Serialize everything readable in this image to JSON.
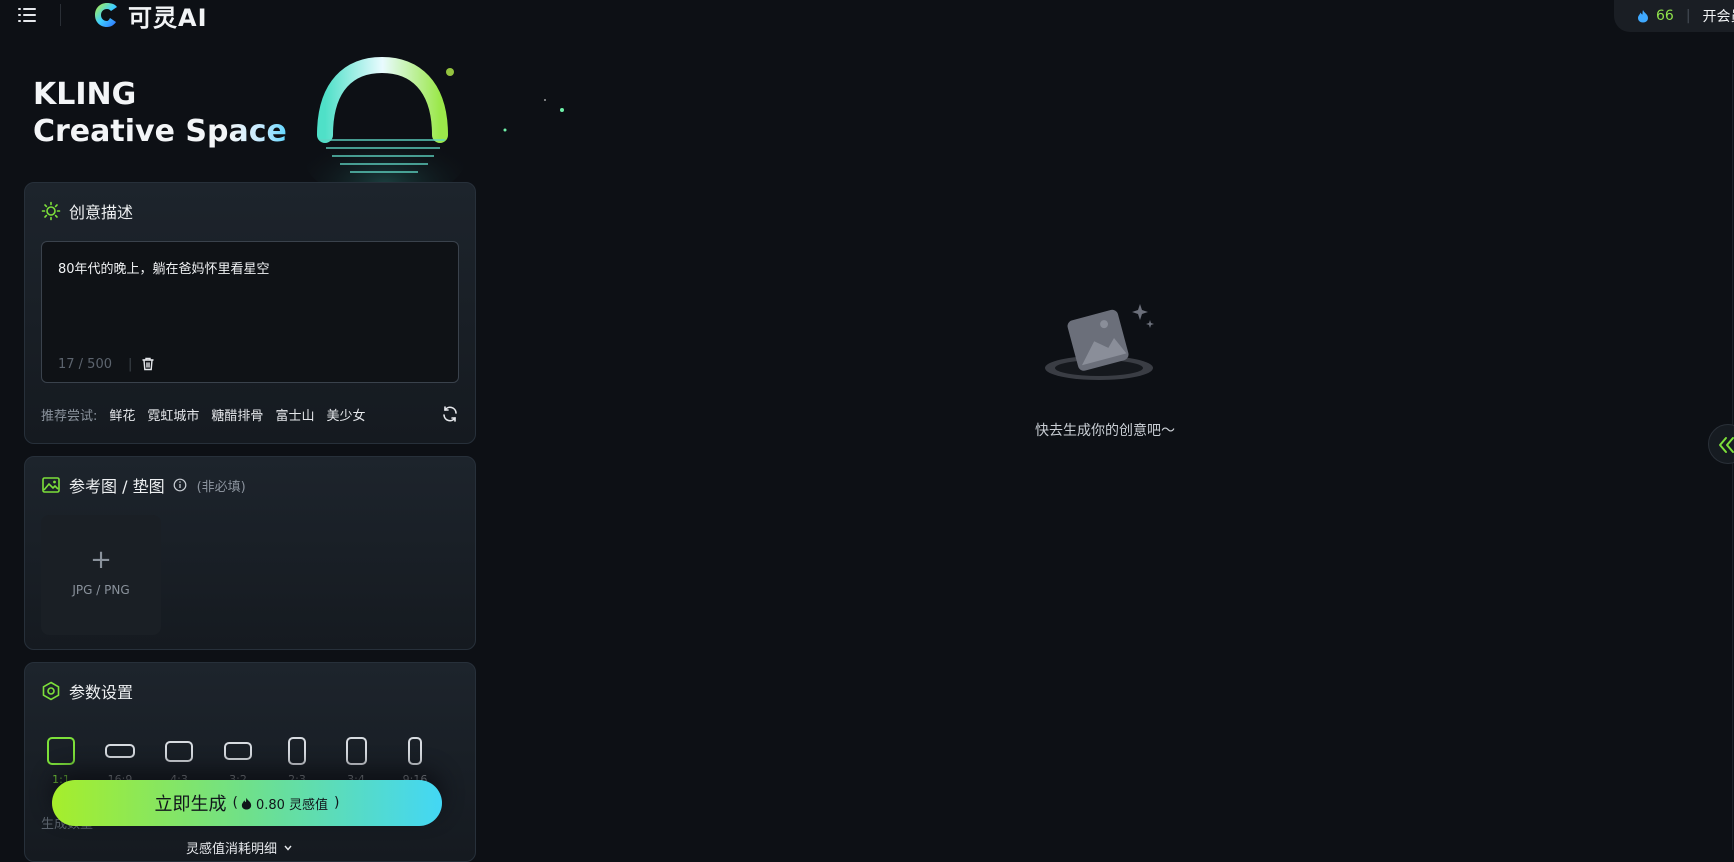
{
  "header": {
    "menu_icon": "menu-icon",
    "app_name": "可灵AI",
    "credits": "66",
    "vip_label": "开会员"
  },
  "hero": {
    "title_line1": "KLING",
    "title_line2_a": "Creative Sp",
    "title_line2_b": "ace"
  },
  "prompt_card": {
    "title": "创意描述",
    "icon": "sun-icon",
    "text": "80年代的晚上，躺在爸妈怀里看星空",
    "count": "17 / 500",
    "suggest_label": "推荐尝试:",
    "suggestions": [
      "鲜花",
      "霓虹城市",
      "糖醋排骨",
      "富士山",
      "美少女"
    ]
  },
  "reference_card": {
    "title": "参考图 / 垫图",
    "optional": "(非必填)",
    "upload_formats": "JPG / PNG"
  },
  "params_card": {
    "title": "参数设置",
    "ratios": [
      "1:1",
      "16:9",
      "4:3",
      "3:2",
      "2:3",
      "3:4",
      "9:16"
    ],
    "selected_ratio": "1:1",
    "gen_count_label": "生成数量"
  },
  "generate": {
    "label": "立即生成",
    "paren_open": "(",
    "cost": "0.80 灵感值",
    "paren_close": ")",
    "detail_link": "灵感值消耗明细"
  },
  "empty_state": {
    "text": "快去生成你的创意吧～"
  },
  "colors": {
    "accent_green": "#7de03a",
    "accent_cyan": "#43d7f5",
    "background": "#0d1015"
  }
}
